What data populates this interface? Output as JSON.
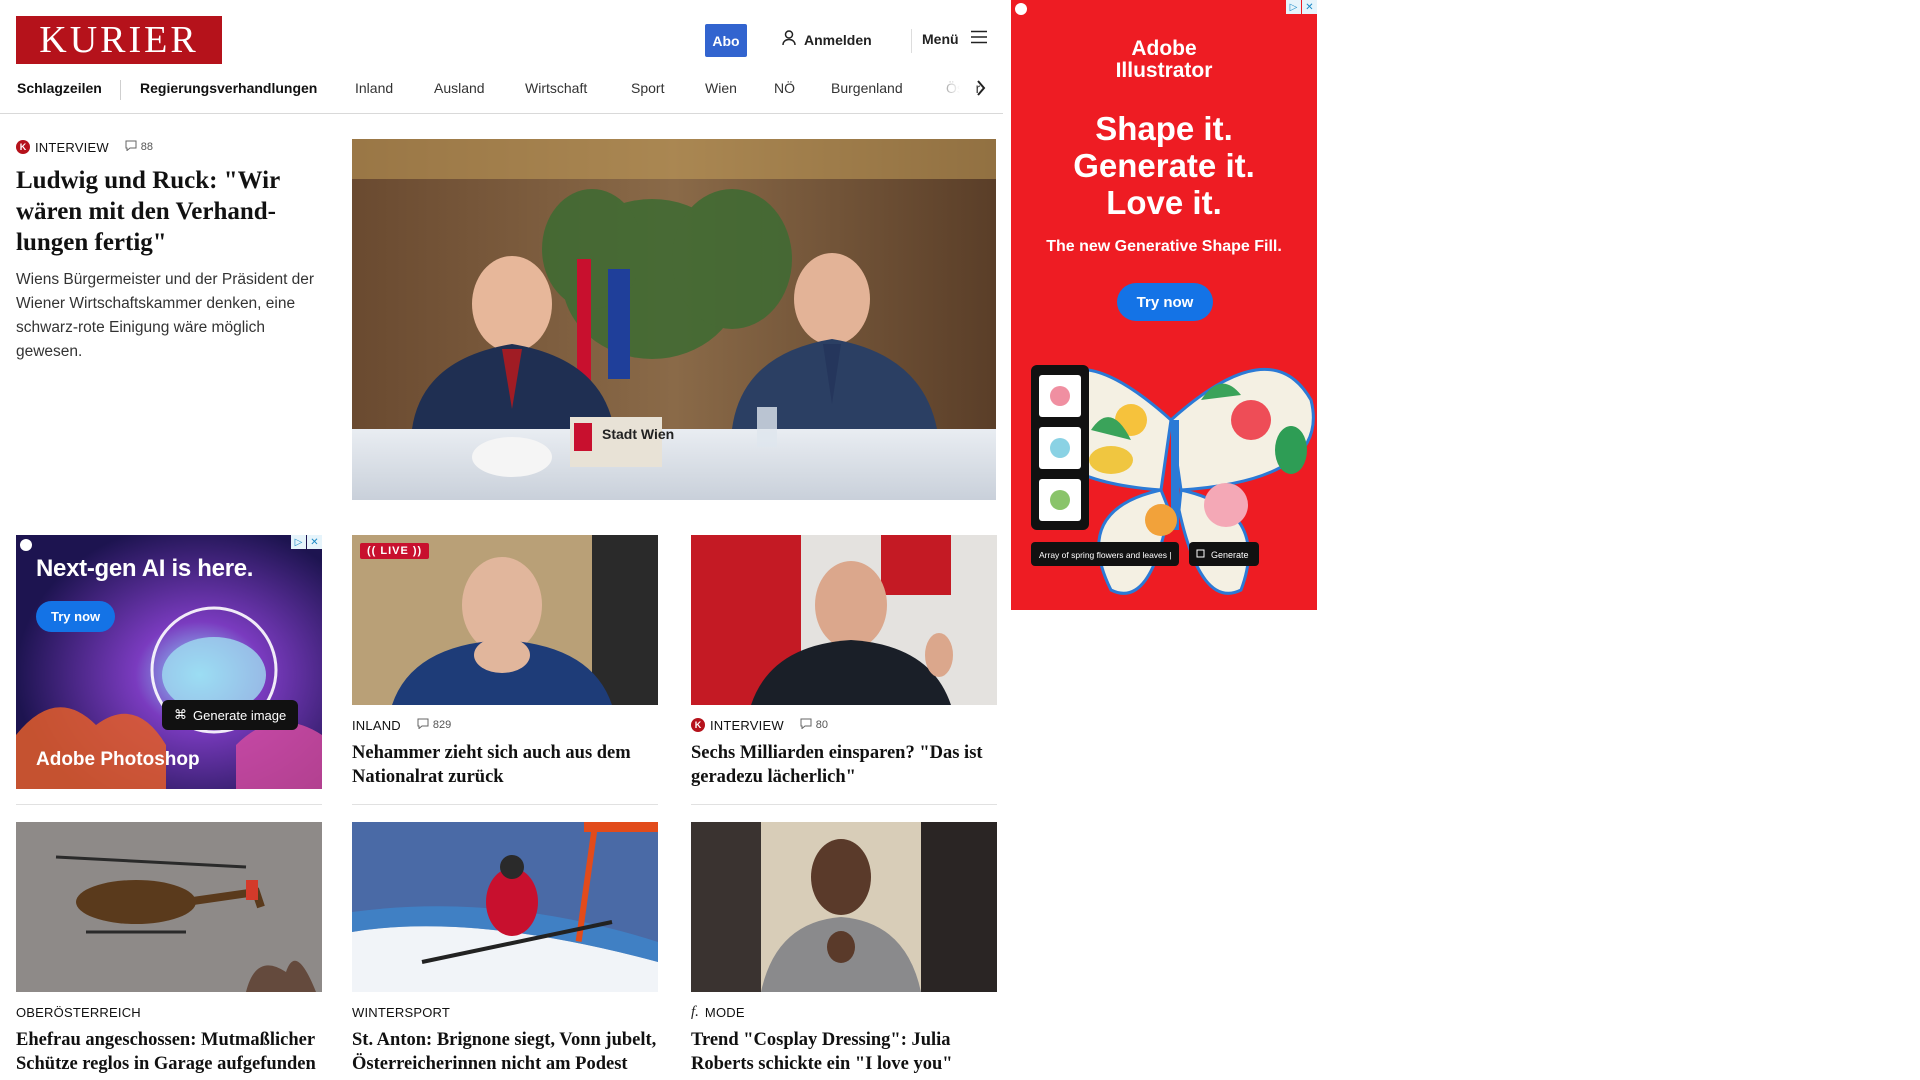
{
  "header": {
    "logo_text": "KURIER",
    "abo_label": "Abo",
    "login_label": "Anmelden",
    "menu_label": "Menü"
  },
  "nav": {
    "items": [
      "Schlagzeilen",
      "Regierungsverhandlungen",
      "Inland",
      "Ausland",
      "Wirtschaft",
      "Sport",
      "Wien",
      "NÖ",
      "Burgenland",
      "Öster"
    ]
  },
  "lead": {
    "kicker": "Interview",
    "comments": "88",
    "title": "Ludwig und Ruck: \"Wir wären mit den Verhand­lungen fertig\"",
    "teaser": "Wiens Bürgermeister und der Präsident der Wiener Wirtschaftskammer denken, eine schwarz-rote Einigung wäre möglich gewesen.",
    "image_sign": "Stadt Wien"
  },
  "cards": [
    {
      "kicker": "Inland",
      "comments": "829",
      "title": "Nehammer zieht sich auch aus dem Nationalrat zurück",
      "badge": "(( LIVE ))"
    },
    {
      "kicker": "Interview",
      "comments": "80",
      "title": "Sechs Milliarden einsparen? \"Das ist geradezu lächerlich\""
    },
    {
      "kicker": "Oberösterreich",
      "title": "Ehefrau angeschossen: Mutmaßli­cher Schütze reglos in Garage aufgefunden"
    },
    {
      "kicker": "Wintersport",
      "title": "St. Anton: Brignone siegt, Vonn ju­belt, Österreicherinnen nicht am Podest"
    },
    {
      "kicker": "Mode",
      "title": "Trend \"Cosplay Dressing\": Julia Roberts schickte ein \"I love you\""
    }
  ],
  "ad_small": {
    "headline": "Next-gen AI is here.",
    "cta": "Try now",
    "chip": "Generate image",
    "brand": "Adobe Photoshop"
  },
  "ad_right": {
    "brand_line1": "Adobe",
    "brand_line2": "Illustrator",
    "headline_1": "Shape it.",
    "headline_2": "Generate it.",
    "headline_3": "Love it.",
    "subline": "The new Generative Shape Fill.",
    "cta": "Try now",
    "prompt": "Array of spring flowers and leaves |",
    "generate": "Generate"
  },
  "colors": {
    "brand_red": "#b5121b",
    "abo_blue": "#3264cf",
    "ad_red": "#ee1c23",
    "live_red": "#c8102e"
  }
}
